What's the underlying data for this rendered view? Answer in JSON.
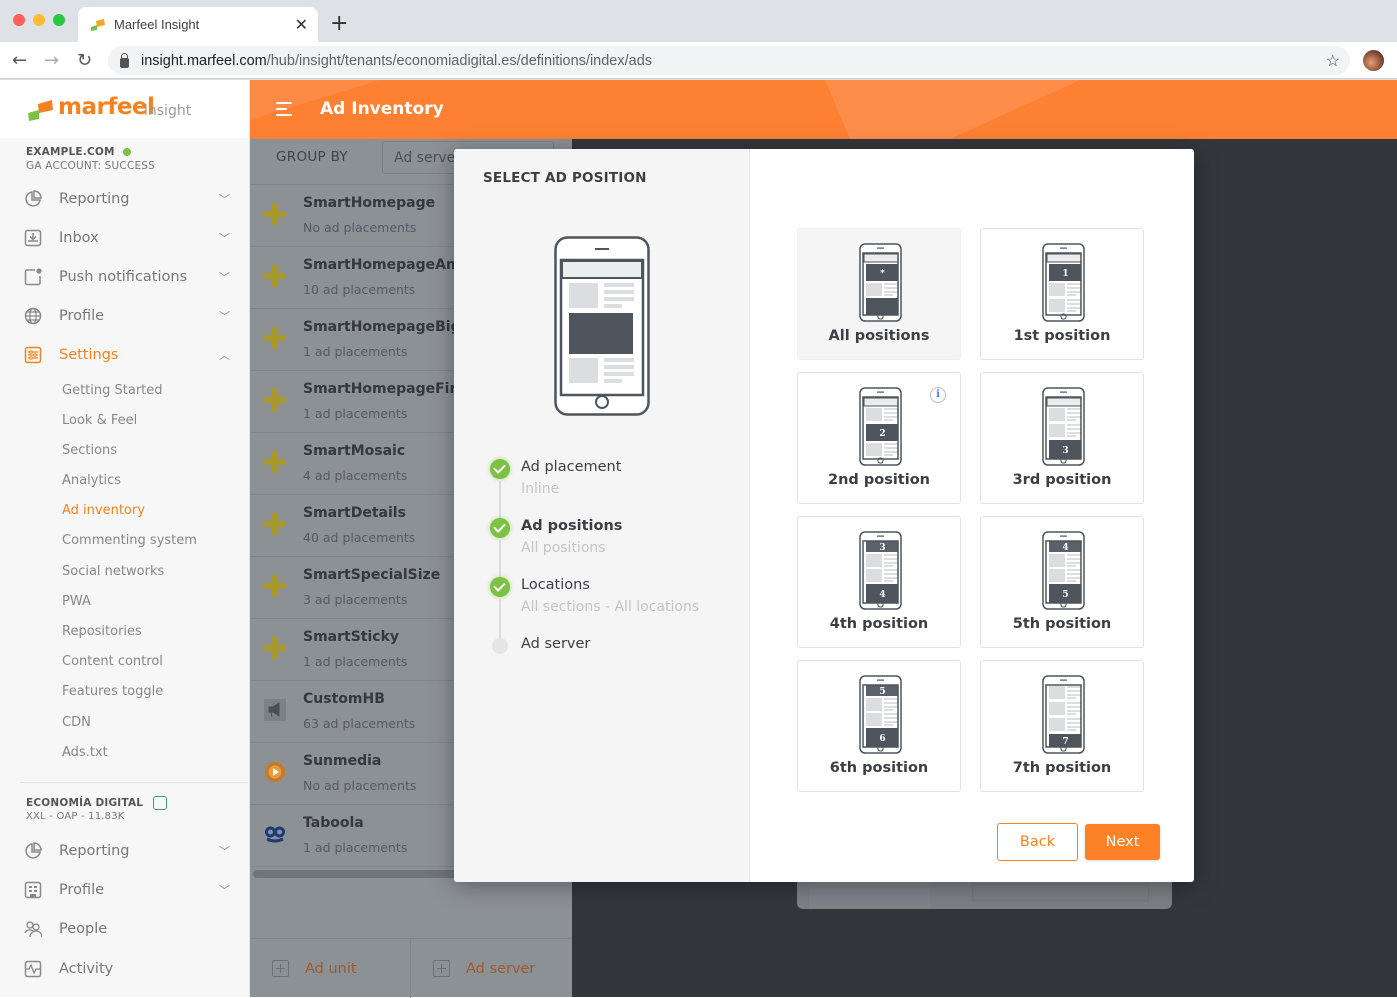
{
  "browser": {
    "tab_title": "Marfeel Insight",
    "url_host": "insight.marfeel.com",
    "url_path": "/hub/insight/tenants/economiadigital.es/definitions/index/ads",
    "traffic_lights": {
      "close": "#fe5f57",
      "minimize": "#febc2e",
      "maximize": "#28c840"
    }
  },
  "sidebar": {
    "logo_brand": "marfeel",
    "logo_product": "insight",
    "account1": {
      "name": "EXAMPLE.COM",
      "status": "GA ACCOUNT: SUCCESS",
      "status_color": "#7cc242"
    },
    "menu1": [
      {
        "label": "Reporting",
        "icon": "pie-chart-icon",
        "expanded": false
      },
      {
        "label": "Inbox",
        "icon": "inbox-icon",
        "expanded": false
      },
      {
        "label": "Push notifications",
        "icon": "push-notification-icon",
        "expanded": false
      },
      {
        "label": "Profile",
        "icon": "globe-icon",
        "expanded": false
      },
      {
        "label": "Settings",
        "icon": "settings-icon",
        "expanded": true,
        "active": true
      }
    ],
    "settings_items": [
      "Getting Started",
      "Look & Feel",
      "Sections",
      "Analytics",
      "Ad inventory",
      "Commenting system",
      "Social networks",
      "PWA",
      "Repositories",
      "Content control",
      "Features toggle",
      "CDN",
      "Ads.txt"
    ],
    "active_settings_item": "Ad inventory",
    "account2": {
      "name": "ECONOMÍA DIGITAL",
      "meta": "XXL - OAP - 11.83K"
    },
    "menu2": [
      {
        "label": "Reporting",
        "icon": "pie-chart-icon",
        "expanded": false
      },
      {
        "label": "Profile",
        "icon": "building-icon",
        "expanded": false
      },
      {
        "label": "People",
        "icon": "people-icon"
      },
      {
        "label": "Activity",
        "icon": "activity-icon"
      }
    ]
  },
  "header": {
    "title": "Ad Inventory",
    "accent": "#fd8033"
  },
  "list": {
    "group_by_label": "GROUP BY",
    "group_by_value": "Ad server",
    "rows": [
      {
        "name": "SmartHomepage",
        "count": "No ad placements",
        "icon": "plus-icon"
      },
      {
        "name": "SmartHomepageAm",
        "count": "10 ad placements",
        "icon": "plus-icon"
      },
      {
        "name": "SmartHomepageBig",
        "count": "1 ad placements",
        "icon": "plus-icon"
      },
      {
        "name": "SmartHomepageFirs",
        "count": "1 ad placements",
        "icon": "plus-icon"
      },
      {
        "name": "SmartMosaic",
        "count": "4 ad placements",
        "icon": "plus-icon"
      },
      {
        "name": "SmartDetails",
        "count": "40 ad placements",
        "icon": "plus-icon"
      },
      {
        "name": "SmartSpecialSize",
        "count": "3 ad placements",
        "icon": "plus-icon"
      },
      {
        "name": "SmartSticky",
        "count": "1 ad placements",
        "icon": "plus-icon"
      },
      {
        "name": "CustomHB",
        "count": "63 ad placements",
        "icon": "megaphone-icon"
      },
      {
        "name": "Sunmedia",
        "count": "No ad placements",
        "icon": "play-icon"
      },
      {
        "name": "Taboola",
        "count": "1 ad placements",
        "icon": "taboola-icon"
      }
    ],
    "add_ad_unit": "Ad unit",
    "add_ad_server": "Ad server"
  },
  "modal": {
    "title": "SELECT AD POSITION",
    "steps": [
      {
        "label": "Ad placement",
        "value": "Inline",
        "done": true,
        "current": false
      },
      {
        "label": "Ad positions",
        "value": "All positions",
        "done": true,
        "current": true
      },
      {
        "label": "Locations",
        "value": "All sections - All locations",
        "done": true,
        "current": false
      },
      {
        "label": "Ad server",
        "value": "",
        "done": false,
        "current": false
      }
    ],
    "options": [
      {
        "label": "All positions",
        "marker": "*",
        "selected": true
      },
      {
        "label": "1st position",
        "marker": "1",
        "selected": false
      },
      {
        "label": "2nd position",
        "marker": "2",
        "selected": false,
        "info": true
      },
      {
        "label": "3rd position",
        "marker": "3",
        "selected": false
      },
      {
        "label": "4th position",
        "marker": "4",
        "prev": "3",
        "selected": false
      },
      {
        "label": "5th position",
        "marker": "5",
        "prev": "4",
        "selected": false
      },
      {
        "label": "6th position",
        "marker": "6",
        "prev": "5",
        "selected": false
      },
      {
        "label": "7th position",
        "marker": "7",
        "selected": false
      }
    ],
    "info_glyph": "i",
    "back_label": "Back",
    "next_label": "Next"
  }
}
